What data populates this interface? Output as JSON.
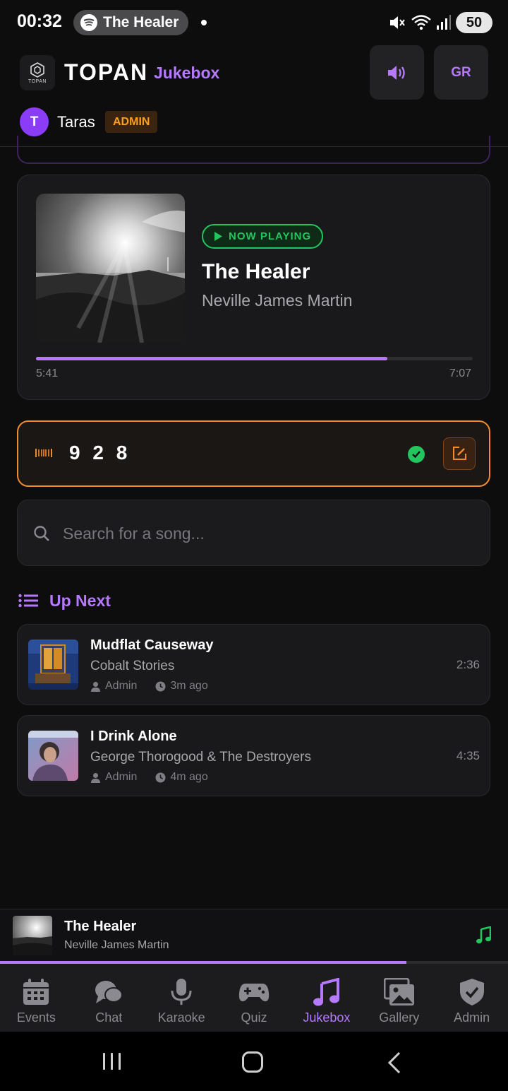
{
  "status_bar": {
    "time": "00:32",
    "media_pill": "The Healer",
    "battery": "50"
  },
  "header": {
    "logo_word": "TOPAN",
    "brand": "TOPAN",
    "section": "Jukebox",
    "lang_button": "GR",
    "user_initial": "T",
    "user_name": "Taras",
    "user_role": "ADMIN"
  },
  "now_playing": {
    "badge": "NOW PLAYING",
    "title": "The Healer",
    "artist": "Neville James Martin",
    "elapsed": "5:41",
    "total": "7:07",
    "progress": 0.805
  },
  "code_card": {
    "value": "9 2 8"
  },
  "search": {
    "placeholder": "Search for a song...",
    "value": ""
  },
  "up_next": {
    "title": "Up Next",
    "items": [
      {
        "title": "Mudflat Causeway",
        "artist": "Cobalt Stories",
        "requested_by": "Admin",
        "age": "3m ago",
        "duration": "2:36"
      },
      {
        "title": "I Drink Alone",
        "artist": "George Thorogood & The Destroyers",
        "requested_by": "Admin",
        "age": "4m ago",
        "duration": "4:35"
      }
    ]
  },
  "mini_player": {
    "title": "The Healer",
    "artist": "Neville James Martin",
    "progress": 0.8
  },
  "tabs": [
    {
      "label": "Events",
      "icon": "calendar-icon"
    },
    {
      "label": "Chat",
      "icon": "chat-icon"
    },
    {
      "label": "Karaoke",
      "icon": "microphone-icon"
    },
    {
      "label": "Quiz",
      "icon": "gamepad-icon"
    },
    {
      "label": "Jukebox",
      "icon": "music-note-icon",
      "active": true
    },
    {
      "label": "Gallery",
      "icon": "gallery-icon"
    },
    {
      "label": "Admin",
      "icon": "shield-check-icon"
    }
  ],
  "colors": {
    "accent": "#b57aff",
    "success": "#22c55e",
    "warning": "#f28a2e",
    "background": "#0d0d0e",
    "card": "#19191b"
  }
}
